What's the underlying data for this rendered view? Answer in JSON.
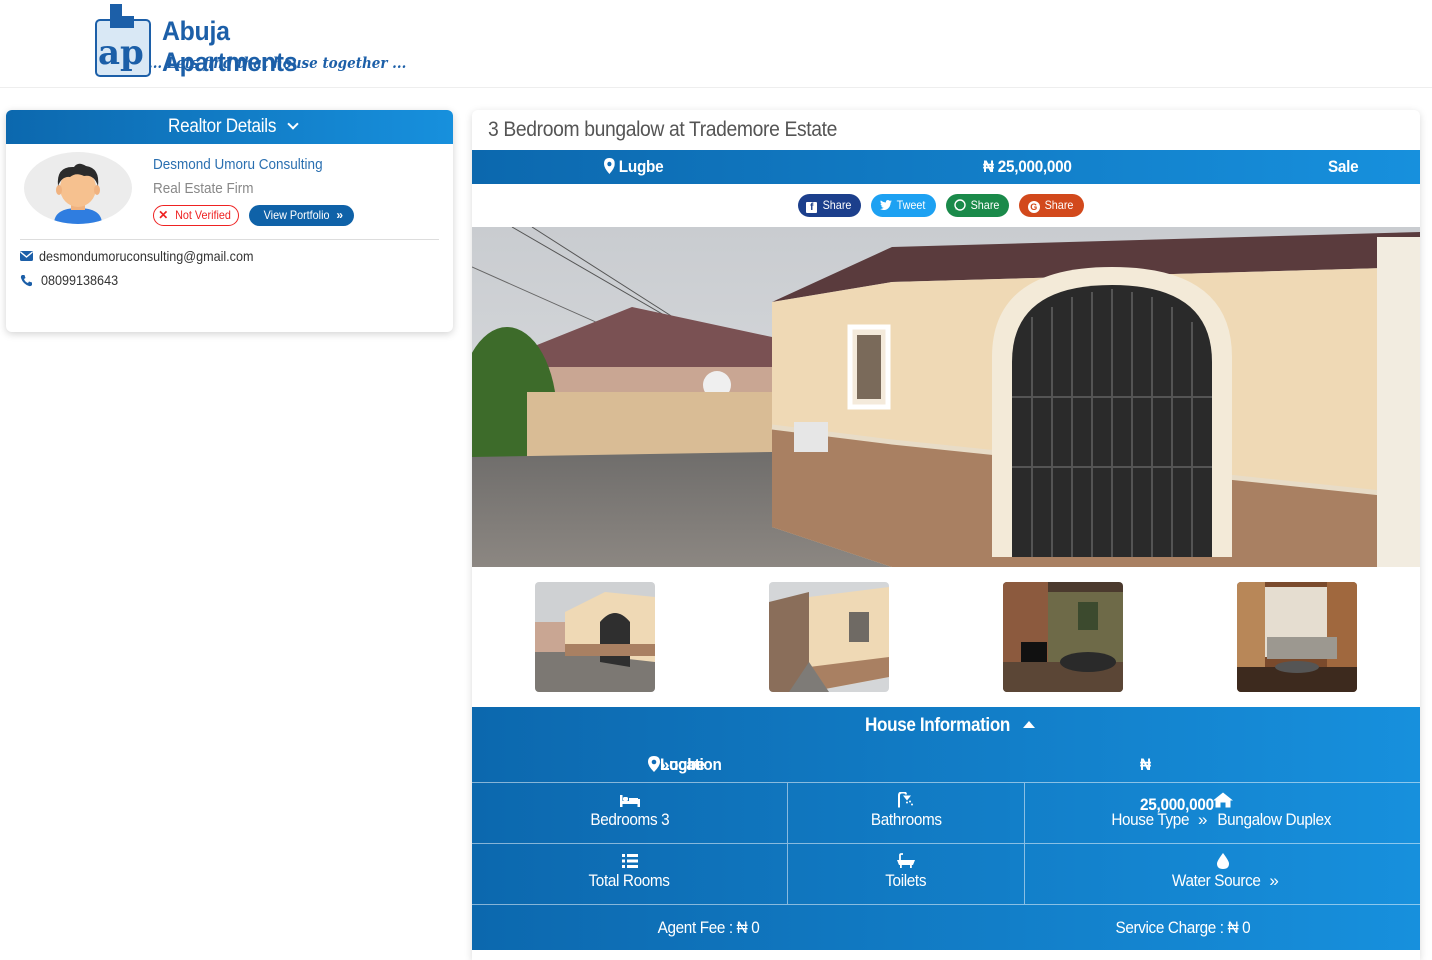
{
  "site": {
    "logo_initials": "ap",
    "name": "Abuja Apartments",
    "tagline": "... Lets find that house together ..."
  },
  "realtor": {
    "header": "Realtor Details",
    "name": "Desmond Umoru Consulting",
    "type": "Real Estate Firm",
    "verification": "Not Verified",
    "portfolio_button": "View Portfolio",
    "email": "desmondumoruconsulting@gmail.com",
    "phone": "08099138643"
  },
  "listing": {
    "title": "3 Bedroom bungalow at Trademore Estate",
    "location": "Lugbe",
    "price": "₦ 25,000,000",
    "status": "Sale",
    "share_buttons": [
      {
        "label": "Share",
        "network": "facebook",
        "color": "#1c3f8c"
      },
      {
        "label": "Tweet",
        "network": "twitter",
        "color": "#1da1f2"
      },
      {
        "label": "Share",
        "network": "whatsapp",
        "color": "#1a8a4a"
      },
      {
        "label": "Share",
        "network": "google-plus",
        "color": "#d2491c"
      }
    ]
  },
  "house_info": {
    "title": "House Information",
    "location_label": "Location",
    "location_value": "Lugbe",
    "price": "₦ 25,000,000",
    "bedrooms": "Bedrooms 3",
    "bathrooms": "Bathrooms",
    "house_type_label": "House Type",
    "house_type_value": "Bungalow Duplex",
    "total_rooms": "Total Rooms",
    "toilets": "Toilets",
    "water_source": "Water Source",
    "agent_fee": "Agent Fee : ₦ 0",
    "service_charge": "Service Charge : ₦ 0"
  },
  "colors": {
    "brand_blue": "#1c5fa8",
    "bar_start": "#0c68ae",
    "bar_end": "#1790dd",
    "not_verified": "#ee2222"
  }
}
